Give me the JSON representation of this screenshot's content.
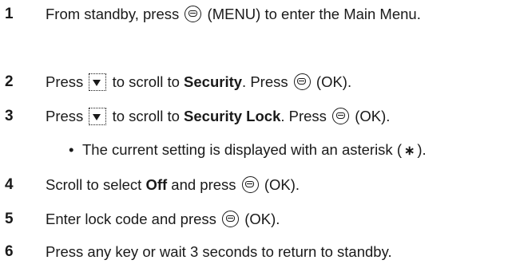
{
  "steps": [
    {
      "number": "1",
      "part1": "From standby, press",
      "icon": "menu-key-icon",
      "part2": "(MENU) to enter the Main Menu."
    },
    {
      "number": "2",
      "part1": "Press",
      "icon1": "scroll-down-icon",
      "part2": "to scroll to",
      "bold": "Security",
      "part3": ". Press",
      "icon2": "menu-key-icon",
      "part4": "(OK)."
    },
    {
      "number": "3",
      "part1": "Press",
      "icon1": "scroll-down-icon",
      "part2": "to scroll to",
      "bold": "Security Lock",
      "part3": ". Press",
      "icon2": "menu-key-icon",
      "part4": "(OK).",
      "bullet": {
        "marker": "•",
        "part1": "The current setting is displayed with an asterisk (",
        "asterisk": "∗",
        "part2": ")."
      }
    },
    {
      "number": "4",
      "part1": "Scroll to select",
      "bold": "Off",
      "part2": "and press",
      "icon": "menu-key-icon",
      "part3": "(OK)."
    },
    {
      "number": "5",
      "part1": "Enter lock code and press",
      "icon": "menu-key-icon",
      "part2": "(OK)."
    },
    {
      "number": "6",
      "part1": "Press any key or wait 3 seconds to return to standby."
    }
  ]
}
